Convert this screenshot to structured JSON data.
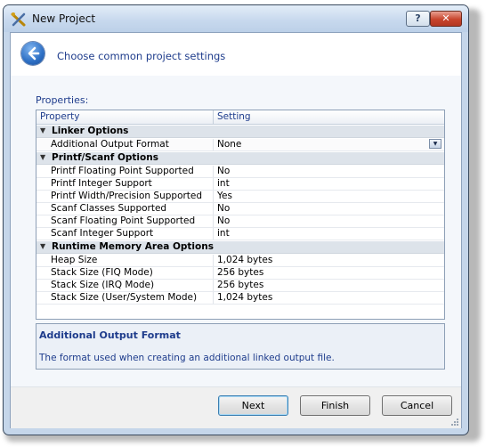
{
  "window": {
    "title": "New Project",
    "help_label": "?",
    "close_label": "✕"
  },
  "header": {
    "instruction": "Choose common project settings"
  },
  "properties": {
    "label": "Properties:",
    "column_headers": [
      "Property",
      "Setting"
    ],
    "linker": {
      "title": "Linker Options",
      "rows": [
        {
          "name": "Additional Output Format",
          "value": "None"
        }
      ]
    },
    "printf": {
      "title": "Printf/Scanf Options",
      "rows": [
        {
          "name": "Printf Floating Point Supported",
          "value": "No"
        },
        {
          "name": "Printf Integer Support",
          "value": "int"
        },
        {
          "name": "Printf Width/Precision Supported",
          "value": "Yes"
        },
        {
          "name": "Scanf Classes Supported",
          "value": "No"
        },
        {
          "name": "Scanf Floating Point Supported",
          "value": "No"
        },
        {
          "name": "Scanf Integer Support",
          "value": "int"
        }
      ]
    },
    "memory": {
      "title": "Runtime Memory Area Options",
      "rows": [
        {
          "name": "Heap Size",
          "value": "1,024 bytes"
        },
        {
          "name": "Stack Size (FIQ Mode)",
          "value": "256 bytes"
        },
        {
          "name": "Stack Size (IRQ Mode)",
          "value": "256 bytes"
        },
        {
          "name": "Stack Size (User/System Mode)",
          "value": "1,024 bytes"
        }
      ]
    }
  },
  "description": {
    "title": "Additional Output Format",
    "text": "The format used when creating an additional linked output file."
  },
  "buttons": {
    "next": "Next",
    "finish": "Finish",
    "cancel": "Cancel"
  },
  "colors": {
    "accent_text": "#1e3c8c",
    "category_bg": "#dde3ea",
    "frame": "#c5d6ea"
  }
}
